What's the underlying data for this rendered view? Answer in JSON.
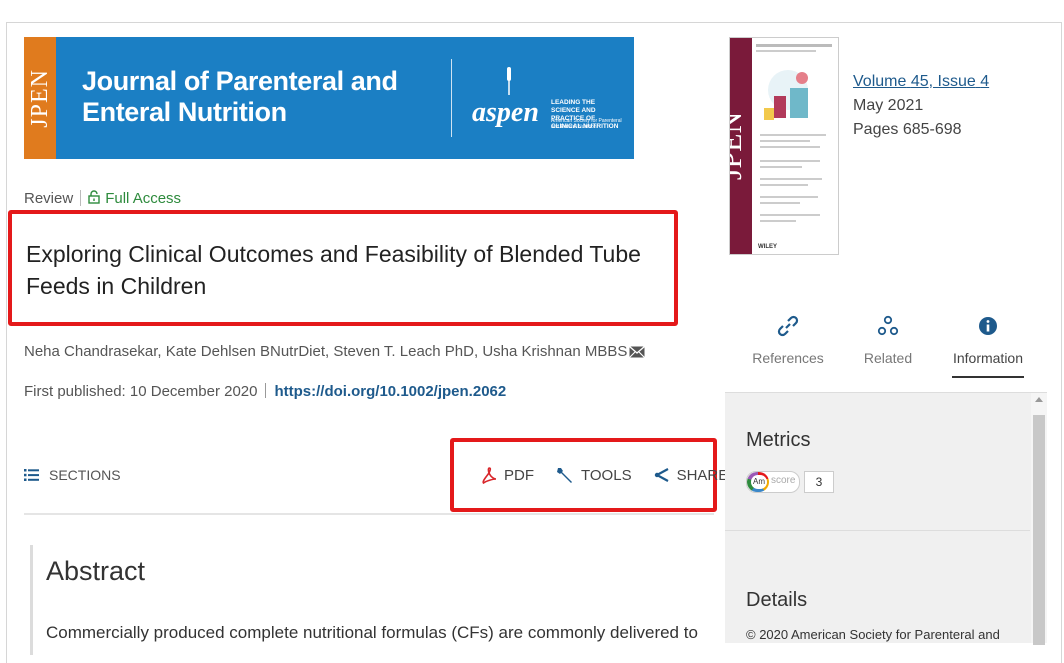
{
  "banner": {
    "jpen": "JPEN",
    "journal_line1": "Journal of Parenteral and",
    "journal_line2": "Enteral Nutrition",
    "aspen": "aspen",
    "aspen_tagline1": "LEADING THE SCIENCE AND",
    "aspen_tagline2": "PRACTICE OF CLINICAL NUTRITION",
    "aspen_subtitle": "American Society for Parenteral and Enteral Nutrition",
    "bg_color": "#1b7fc4",
    "accent_color": "#e07b1e"
  },
  "article": {
    "type": "Review",
    "access": "Full Access",
    "title": "Exploring Clinical Outcomes and Feasibility of Blended Tube Feeds in Children",
    "authors": "Neha Chandrasekar, Kate Dehlsen BNutrDiet, Steven T. Leach PhD, Usha Krishnan MBBS",
    "first_published_label": "First published:",
    "first_published_date": "10 December 2020",
    "doi": "https://doi.org/10.1002/jpen.2062"
  },
  "toolbar": {
    "sections_label": "SECTIONS",
    "pdf_label": "PDF",
    "tools_label": "TOOLS",
    "share_label": "SHARE"
  },
  "abstract": {
    "heading": "Abstract",
    "first_line": "Commercially produced complete nutritional formulas (CFs) are commonly delivered to"
  },
  "issue": {
    "volume_label": "Volume",
    "volume": "45",
    "issue_label": "Issue",
    "issue": "4",
    "date": "May 2021",
    "pages": "Pages 685-698"
  },
  "cover": {
    "jpen": "JPEN",
    "publisher": "WILEY"
  },
  "tabs": [
    {
      "label": "References",
      "icon": "link-icon"
    },
    {
      "label": "Related",
      "icon": "related-icon"
    },
    {
      "label": "Information",
      "icon": "info-icon"
    }
  ],
  "panel": {
    "metrics_heading": "Metrics",
    "altmetric_badge": "Am",
    "altmetric_label": "score",
    "altmetric_score": "3",
    "details_heading": "Details",
    "copyright": "© 2020 American Society for Parenteral and"
  },
  "colors": {
    "highlight": "#e4191a",
    "link": "#1e5a8c",
    "access_green": "#2e8b3d"
  }
}
